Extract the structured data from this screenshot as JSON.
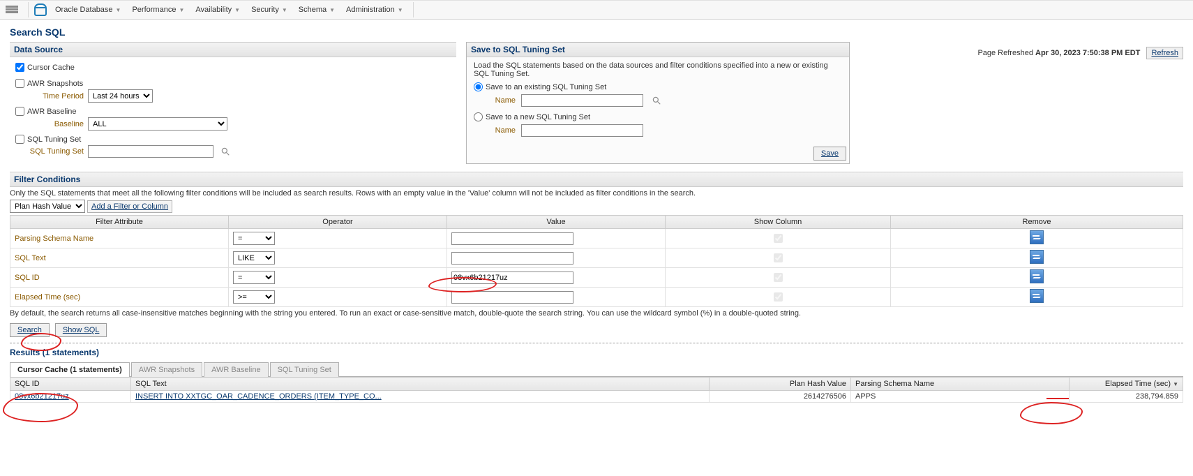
{
  "menu": {
    "items": [
      "Oracle Database",
      "Performance",
      "Availability",
      "Security",
      "Schema",
      "Administration"
    ]
  },
  "page": {
    "title": "Search SQL",
    "refreshed_label": "Page Refreshed",
    "refreshed_time": "Apr 30, 2023 7:50:38 PM EDT",
    "refresh_btn": "Refresh"
  },
  "datasource": {
    "head": "Data Source",
    "cursor_cache": {
      "label": "Cursor Cache",
      "checked": true
    },
    "awr_snapshots": {
      "label": "AWR Snapshots",
      "checked": false,
      "time_period_label": "Time Period",
      "time_period_value": "Last 24 hours"
    },
    "awr_baseline": {
      "label": "AWR Baseline",
      "checked": false,
      "baseline_label": "Baseline",
      "baseline_value": "ALL"
    },
    "sql_tuning_set": {
      "label": "SQL Tuning Set",
      "checked": false,
      "sts_label": "SQL Tuning Set",
      "sts_value": ""
    }
  },
  "sts_panel": {
    "head": "Save to SQL Tuning Set",
    "desc": "Load the SQL statements based on the data sources and filter conditions specified into a new or existing SQL Tuning Set.",
    "opt_existing": "Save to an existing SQL Tuning Set",
    "opt_new": "Save to a new SQL Tuning Set",
    "name_label": "Name",
    "save_btn": "Save"
  },
  "filters": {
    "head": "Filter Conditions",
    "hint": "Only the SQL statements that meet all the following filter conditions will be included as search results. Rows with an empty value in the 'Value' column will not be included as filter conditions in the search.",
    "add_select": "Plan Hash Value",
    "add_link": "Add a Filter or Column",
    "cols": {
      "attr": "Filter Attribute",
      "op": "Operator",
      "val": "Value",
      "show": "Show Column",
      "rem": "Remove"
    },
    "rows": [
      {
        "attr": "Parsing Schema Name",
        "op": "=",
        "val": ""
      },
      {
        "attr": "SQL Text",
        "op": "LIKE",
        "val": ""
      },
      {
        "attr": "SQL ID",
        "op": "=",
        "val": "08vx6b21217uz"
      },
      {
        "attr": "Elapsed Time (sec)",
        "op": ">=",
        "val": ""
      }
    ],
    "footnote": "By default, the search returns all case-insensitive matches beginning with the string you entered. To run an exact or case-sensitive match, double-quote the search string. You can use the wildcard symbol (%) in a double-quoted string.",
    "search_btn": "Search",
    "showsql_btn": "Show SQL"
  },
  "results": {
    "title": "Results (1 statements)",
    "tabs": [
      "Cursor Cache (1 statements)",
      "AWR Snapshots",
      "AWR Baseline",
      "SQL Tuning Set"
    ],
    "active_tab": 0,
    "cols": {
      "sqlid": "SQL ID",
      "sqltext": "SQL Text",
      "phv": "Plan Hash Value",
      "schema": "Parsing Schema Name",
      "elapsed": "Elapsed Time (sec)"
    },
    "row": {
      "sqlid": "08vx6b21217uz",
      "sqltext": "INSERT INTO XXTGC_OAR_CADENCE_ORDERS (ITEM_TYPE_CO...",
      "phv": "2614276506",
      "schema": "APPS",
      "elapsed": "238,794.859"
    }
  }
}
